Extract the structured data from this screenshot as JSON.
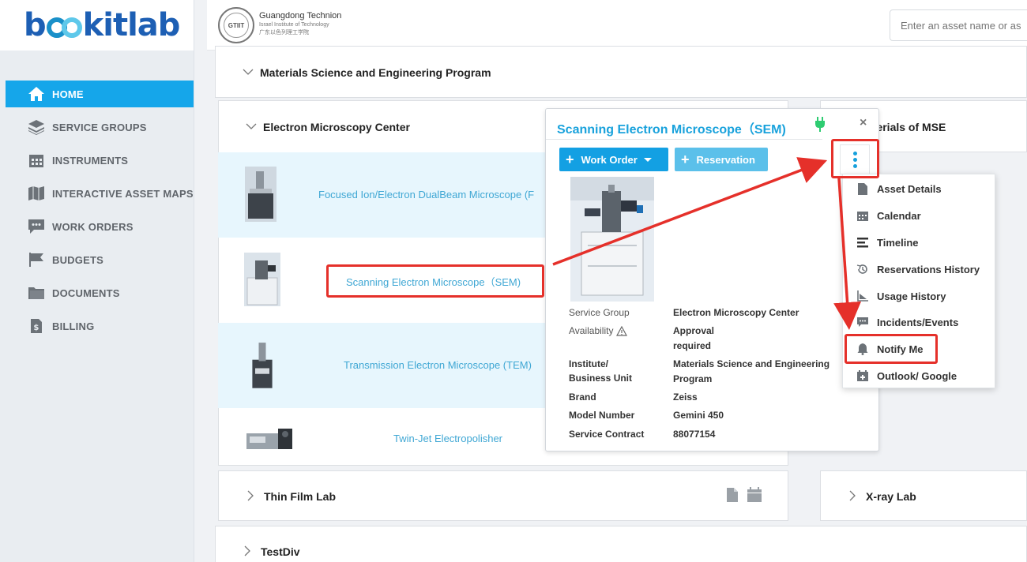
{
  "brand": {
    "logo_prefix": "b",
    "logo_suffix": "kitlab"
  },
  "sidebar": {
    "items": [
      {
        "label": "HOME",
        "icon": "home-icon",
        "active": true
      },
      {
        "label": "SERVICE GROUPS",
        "icon": "layers-icon"
      },
      {
        "label": "INSTRUMENTS",
        "icon": "calendar-grid-icon"
      },
      {
        "label": "INTERACTIVE ASSET MAPS",
        "icon": "map-icon"
      },
      {
        "label": "WORK ORDERS",
        "icon": "chat-icon"
      },
      {
        "label": "BUDGETS",
        "icon": "flag-icon"
      },
      {
        "label": "DOCUMENTS",
        "icon": "folder-icon"
      },
      {
        "label": "BILLING",
        "icon": "dollar-doc-icon"
      }
    ]
  },
  "header": {
    "org_name": "Guangdong Technion",
    "org_sub_en": "Israel Institute of Technology",
    "org_sub_cn": "广东以色列理工学院",
    "seal_text": "GTIIT",
    "search_placeholder": "Enter an asset name or as"
  },
  "sections": {
    "mse": "Materials Science and Engineering Program",
    "emc": "Electron Microscopy Center",
    "mse_right": "aterials of MSE",
    "thin_film": "Thin Film Lab",
    "xray": "X-ray Lab",
    "testdiv": "TestDiv"
  },
  "instruments": [
    {
      "name": "Focused Ion/Electron DualBeam Microscope (F",
      "highlight": true
    },
    {
      "name": "Scanning Electron Microscope（SEM)",
      "highlight": false
    },
    {
      "name": "Transmission Electron Microscope (TEM)",
      "highlight": true
    },
    {
      "name": "Twin-Jet Electropolisher",
      "highlight": false
    }
  ],
  "popup": {
    "title": "Scanning Electron Microscope（SEM)",
    "close": "×",
    "work_order_btn": "Work Order",
    "reservation_btn": "Reservation",
    "details": {
      "service_group_label": "Service Group",
      "service_group_value": "Electron Microscopy Center",
      "availability_label": "Availability",
      "availability_value": "Approval required",
      "institute_label": "Institute/ Business Unit",
      "institute_value": "Materials Science and Engineering Program",
      "brand_label": "Brand",
      "brand_value": "Zeiss",
      "model_label": "Model Number",
      "model_value": "Gemini 450",
      "contract_label": "Service Contract",
      "contract_value": "88077154"
    }
  },
  "menu": {
    "items": [
      {
        "label": "Asset Details",
        "icon": "document-icon"
      },
      {
        "label": "Calendar",
        "icon": "calendar-icon"
      },
      {
        "label": "Timeline",
        "icon": "timeline-icon"
      },
      {
        "label": "Reservations History",
        "icon": "history-icon"
      },
      {
        "label": "Usage History",
        "icon": "chart-icon"
      },
      {
        "label": "Incidents/Events",
        "icon": "comment-icon"
      },
      {
        "label": "Notify Me",
        "icon": "bell-icon"
      },
      {
        "label": "Outlook/ Google",
        "icon": "calendar-plus-icon"
      }
    ]
  },
  "colors": {
    "accent": "#15a6ea",
    "link": "#3fa7d4",
    "annotation": "#e5302a",
    "plug": "#2ecc71"
  }
}
